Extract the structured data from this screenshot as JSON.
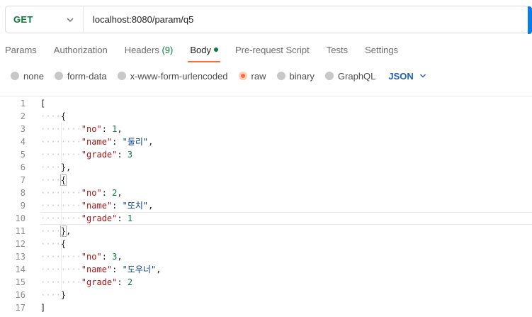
{
  "request": {
    "method": "GET",
    "url": "localhost:8080/param/q5"
  },
  "tabs": [
    {
      "label": "Params",
      "count": "",
      "active": false
    },
    {
      "label": "Authorization",
      "count": "",
      "active": false
    },
    {
      "label": "Headers",
      "count": "(9)",
      "active": false
    },
    {
      "label": "Body",
      "count": "",
      "active": true,
      "dot": true
    },
    {
      "label": "Pre-request Script",
      "count": "",
      "active": false
    },
    {
      "label": "Tests",
      "count": "",
      "active": false
    },
    {
      "label": "Settings",
      "count": "",
      "active": false
    }
  ],
  "body_types": [
    {
      "label": "none",
      "selected": false
    },
    {
      "label": "form-data",
      "selected": false
    },
    {
      "label": "x-www-form-urlencoded",
      "selected": false
    },
    {
      "label": "raw",
      "selected": true
    },
    {
      "label": "binary",
      "selected": false
    },
    {
      "label": "GraphQL",
      "selected": false
    }
  ],
  "format_select": {
    "value": "JSON"
  },
  "editor": {
    "active_line": 10,
    "lines": [
      {
        "n": "1",
        "indent": 0,
        "tokens": [
          {
            "t": "p",
            "v": "["
          }
        ]
      },
      {
        "n": "2",
        "indent": 1,
        "tokens": [
          {
            "t": "p",
            "v": "{"
          }
        ]
      },
      {
        "n": "3",
        "indent": 2,
        "tokens": [
          {
            "t": "k",
            "v": "\"no\""
          },
          {
            "t": "p",
            "v": ": "
          },
          {
            "t": "n",
            "v": "1"
          },
          {
            "t": "p",
            "v": ","
          }
        ]
      },
      {
        "n": "4",
        "indent": 2,
        "tokens": [
          {
            "t": "k",
            "v": "\"name\""
          },
          {
            "t": "p",
            "v": ": "
          },
          {
            "t": "s",
            "v": "\"둘리\""
          },
          {
            "t": "p",
            "v": ","
          }
        ]
      },
      {
        "n": "5",
        "indent": 2,
        "tokens": [
          {
            "t": "k",
            "v": "\"grade\""
          },
          {
            "t": "p",
            "v": ": "
          },
          {
            "t": "n",
            "v": "3"
          }
        ]
      },
      {
        "n": "6",
        "indent": 1,
        "tokens": [
          {
            "t": "p",
            "v": "},"
          }
        ]
      },
      {
        "n": "7",
        "indent": 1,
        "tokens": [
          {
            "t": "b",
            "v": "{"
          }
        ]
      },
      {
        "n": "8",
        "indent": 2,
        "tokens": [
          {
            "t": "k",
            "v": "\"no\""
          },
          {
            "t": "p",
            "v": ": "
          },
          {
            "t": "n",
            "v": "2"
          },
          {
            "t": "p",
            "v": ","
          }
        ]
      },
      {
        "n": "9",
        "indent": 2,
        "tokens": [
          {
            "t": "k",
            "v": "\"name\""
          },
          {
            "t": "p",
            "v": ": "
          },
          {
            "t": "s",
            "v": "\"또치\""
          },
          {
            "t": "p",
            "v": ","
          }
        ]
      },
      {
        "n": "10",
        "indent": 2,
        "tokens": [
          {
            "t": "k",
            "v": "\"grade\""
          },
          {
            "t": "p",
            "v": ": "
          },
          {
            "t": "n",
            "v": "1"
          }
        ]
      },
      {
        "n": "11",
        "indent": 1,
        "tokens": [
          {
            "t": "b",
            "v": "}"
          },
          {
            "t": "p",
            "v": ","
          }
        ]
      },
      {
        "n": "12",
        "indent": 1,
        "tokens": [
          {
            "t": "p",
            "v": "{"
          }
        ]
      },
      {
        "n": "13",
        "indent": 2,
        "tokens": [
          {
            "t": "k",
            "v": "\"no\""
          },
          {
            "t": "p",
            "v": ": "
          },
          {
            "t": "n",
            "v": "3"
          },
          {
            "t": "p",
            "v": ","
          }
        ]
      },
      {
        "n": "14",
        "indent": 2,
        "tokens": [
          {
            "t": "k",
            "v": "\"name\""
          },
          {
            "t": "p",
            "v": ": "
          },
          {
            "t": "s",
            "v": "\"도우너\""
          },
          {
            "t": "p",
            "v": ","
          }
        ]
      },
      {
        "n": "15",
        "indent": 2,
        "tokens": [
          {
            "t": "k",
            "v": "\"grade\""
          },
          {
            "t": "p",
            "v": ": "
          },
          {
            "t": "n",
            "v": "2"
          }
        ]
      },
      {
        "n": "16",
        "indent": 1,
        "tokens": [
          {
            "t": "p",
            "v": "}"
          }
        ]
      },
      {
        "n": "17",
        "indent": 0,
        "tokens": [
          {
            "t": "p",
            "v": "]"
          }
        ]
      }
    ]
  },
  "icons": {
    "method_dropdown": "chevron-down-icon",
    "format_dropdown": "chevron-down-icon"
  },
  "colors": {
    "method": "#0b7a3e",
    "active_tab_underline": "#ff6c37",
    "radio_selected": "#ff6c37",
    "format_select": "#1f5fbf",
    "send_button": "#097bed"
  }
}
